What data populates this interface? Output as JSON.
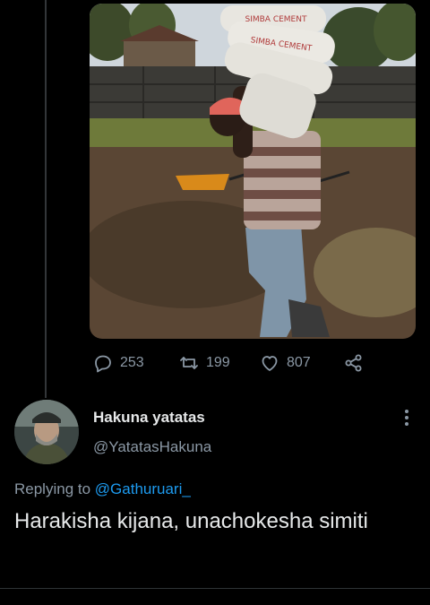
{
  "previous_tweet": {
    "media": {
      "bag_print": "SIMBA CEMENT"
    },
    "stats": {
      "replies": "253",
      "retweets": "199",
      "likes": "807"
    }
  },
  "reply_tweet": {
    "author": {
      "display_name": "Hakuna yatatas",
      "handle": "@YatatasHakuna"
    },
    "replying_to": {
      "prefix": "Replying to",
      "mention": "@Gathuruari_"
    },
    "text": "Harakisha kijana, unachokesha simiti"
  },
  "icons": {
    "reply": "speech-bubble-icon",
    "retweet": "retweet-arrows-icon",
    "like": "heart-icon",
    "share": "share-nodes-icon",
    "more": "vertical-dots-icon"
  },
  "colors": {
    "background": "#000000",
    "primary_text": "#e7e9ea",
    "secondary_text": "#8b98a5",
    "link": "#1d9bf0"
  }
}
